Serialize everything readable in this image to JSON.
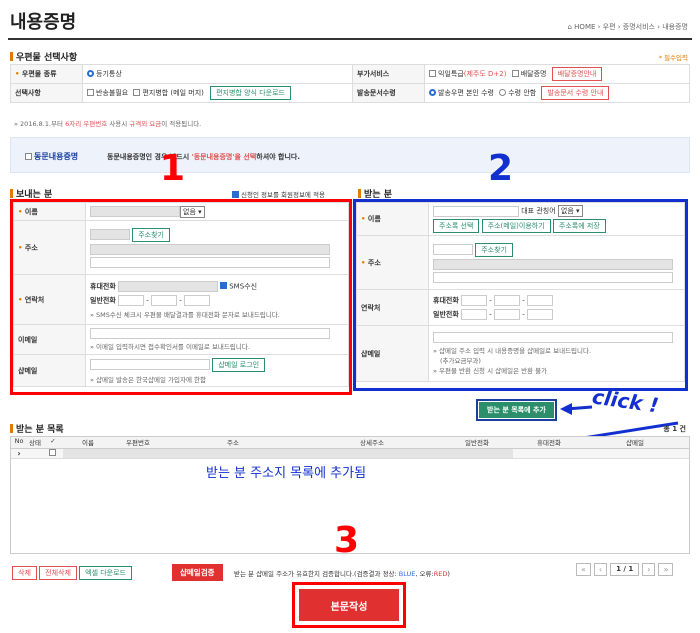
{
  "page": {
    "title": "내용증명",
    "breadcrumb": "HOME  ›  우편  ›  증명서비스  ›  내용증명",
    "required_note": "* 필수입력"
  },
  "postal": {
    "section_title": "우편물 선택사항",
    "type_label": "우편물 종류",
    "type_value": "등기통상",
    "extra_label": "부가서비스",
    "extra_next": "익일특급",
    "extra_next_note": "(제주도 D+2)",
    "extra_delivery": "배달증명",
    "extra_delivery_btn": "배달증명안내",
    "option_label": "선택사항",
    "opt_return": "반송불필요",
    "opt_merge": "편지병합 (메일 머지)",
    "merge_btn": "편지병합 양식 다운로드",
    "receive_label": "발송문서수령",
    "recv_self": "발송우편 본인 수령",
    "recv_none": "수령 안함",
    "recv_btn": "발송문서 수령 안내"
  },
  "notice": {
    "prefix": "2016.8.1.부터 ",
    "red1": "6자리 우편번호",
    "mid": " 사용시 ",
    "red2": "규격외 요금",
    "suffix": "이 적용됩니다."
  },
  "same": {
    "label": "동문내용증명",
    "text1": "동문내용증명인 경우 반드시 ",
    "text2": "'동문내용증명'을 선택",
    "text3": "하셔야 합니다."
  },
  "sender": {
    "title": "보내는 분",
    "apply_info": "신청인 정보를 회원정보에 적용",
    "name_label": "이름",
    "name_select": "없음",
    "addr_label": "주소",
    "addr_btn": "주소찾기",
    "contact_label": "연락처",
    "mobile_label": "휴대전화",
    "sms_label": "SMS수신",
    "phone_label": "일반전화",
    "sms_note": "SMS수신 체크시 우편물 배달결과를 휴대전화 문자로 보내드립니다.",
    "email_label": "이메일",
    "email_note": "이메일 입력하시면 접수확인서를 이메일로 보내드립니다.",
    "shmail_label": "샵메일",
    "shmail_btn": "샵메일 로그인",
    "shmail_note": "샵메일 발송은 한국샵메일 가입자에 한함"
  },
  "receiver": {
    "title": "받는 분",
    "name_label": "이름",
    "title_label": "대표 관칭어",
    "title_select": "없음",
    "btn_book_select": "주소록 선택",
    "btn_book_mail": "주소(메일)이용하기",
    "btn_book_save": "주소록에 저장",
    "addr_label": "주소",
    "addr_btn": "주소찾기",
    "contact_label": "연락처",
    "mobile_label": "휴대전화",
    "phone_label": "일반전화",
    "shmail_label": "샵메일",
    "shmail_note1": "샵메일 주소 입력 시 내용증명을 샵메일로 보내드립니다.",
    "shmail_note2": "(추가요금부과)",
    "shmail_note3": "우편물 반환 신청 시 샵메일은 반환 불가",
    "add_btn": "받는 분 목록에 추가"
  },
  "list": {
    "title": "받는 분 목록",
    "count": "총 1 건",
    "columns": [
      "No",
      "상태",
      "✓",
      "이름",
      "우편번호",
      "주소",
      "상세주소",
      "일반전화",
      "휴대전화",
      "샵메일"
    ],
    "row_marker": "›"
  },
  "bottom": {
    "btn_delete": "삭제",
    "btn_delete_all": "전체삭제",
    "btn_excel": "엑셀 다운로드",
    "btn_verify": "샵메일검증",
    "verify_note1": "받는 분 샵메일 주소",
    "verify_note2": "유효한지 검증합니다.(검증결과 정상:",
    "verify_ok": "BLUE",
    "verify_mid": ", 오류:",
    "verify_err": "RED",
    "verify_end": ")",
    "page_info": "1 / 1",
    "btn_compose": "본문작성"
  },
  "annotations": {
    "num1": "1",
    "num2": "2",
    "num3": "3",
    "click": "click !",
    "added": "받는 분 주소지 목록에 추가됨"
  },
  "colors": {
    "accent": "#e07b00",
    "green": "#2a8f6a",
    "red": "#f00000",
    "blue": "#1230d0",
    "compose": "#e03030"
  }
}
